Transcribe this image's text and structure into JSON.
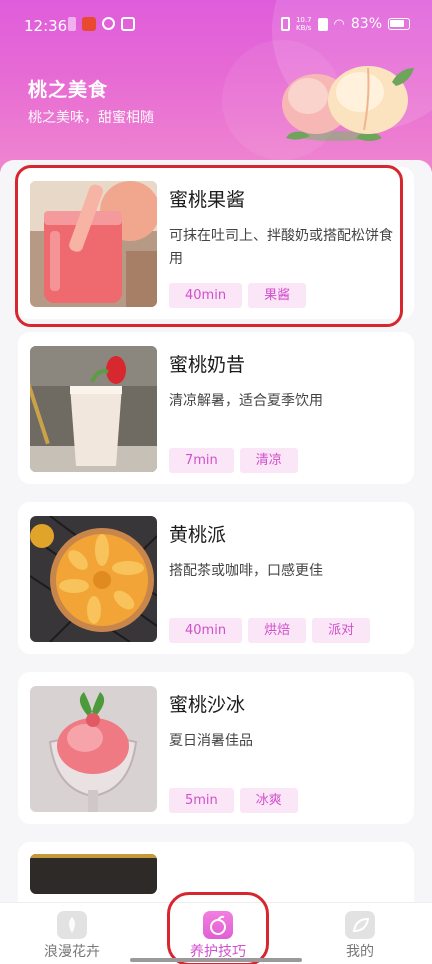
{
  "statusbar": {
    "time": "12:36",
    "speed_top": "10.7",
    "speed_bottom": "KB/s",
    "battery": "83%"
  },
  "header": {
    "title": "桃之美食",
    "subtitle": "桃之美味，甜蜜相随"
  },
  "recipes": [
    {
      "title": "蜜桃果酱",
      "desc": "可抹在吐司上、拌酸奶或搭配松饼食用",
      "tags": [
        "40min",
        "果酱"
      ]
    },
    {
      "title": "蜜桃奶昔",
      "desc": "清凉解暑，适合夏季饮用",
      "tags": [
        "7min",
        "清凉"
      ]
    },
    {
      "title": "黄桃派",
      "desc": "搭配茶或咖啡，口感更佳",
      "tags": [
        "40min",
        "烘焙",
        "派对"
      ]
    },
    {
      "title": "蜜桃沙冰",
      "desc": "夏日消暑佳品",
      "tags": [
        "5min",
        "冰爽"
      ]
    }
  ],
  "nav": {
    "items": [
      {
        "label": "浪漫花卉",
        "icon": "flower-icon"
      },
      {
        "label": "养护技巧",
        "icon": "peach-icon"
      },
      {
        "label": "我的",
        "icon": "leaf-icon"
      }
    ]
  },
  "colors": {
    "accent": "#d24fcf",
    "header_gradient_start": "#df5ddc",
    "highlight_border": "#d8262e",
    "tag_bg": "#fbe6f7"
  }
}
